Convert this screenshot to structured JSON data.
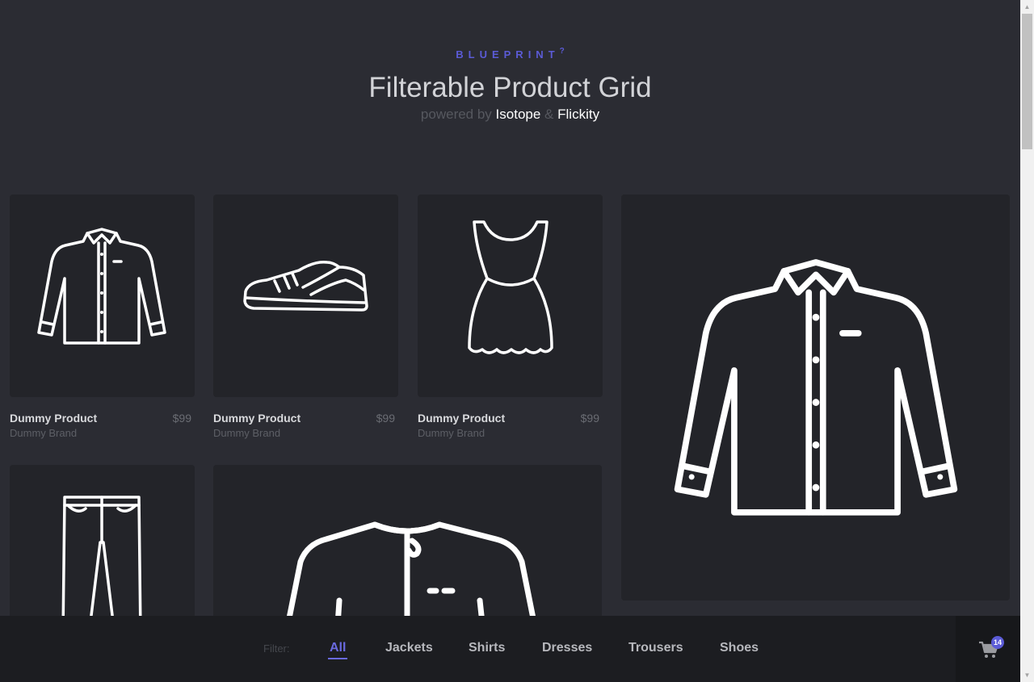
{
  "header": {
    "logo": "BLUEPRINT",
    "logo_sup": "?",
    "title": "Filterable Product Grid",
    "subtitle_prefix": "powered by",
    "link1": "Isotope",
    "amp": "&",
    "link2": "Flickity"
  },
  "products": [
    {
      "name": "Dummy Product",
      "brand": "Dummy Brand",
      "price": "$99",
      "icon": "shirt-icon"
    },
    {
      "name": "Dummy Product",
      "brand": "Dummy Brand",
      "price": "$99",
      "icon": "shoe-icon"
    },
    {
      "name": "Dummy Product",
      "brand": "Dummy Brand",
      "price": "$99",
      "icon": "dress-icon"
    },
    {
      "name": "",
      "brand": "",
      "price": "",
      "icon": "shirt-icon"
    },
    {
      "name": "",
      "brand": "",
      "price": "",
      "icon": "trousers-icon"
    },
    {
      "name": "",
      "brand": "",
      "price": "",
      "icon": "jacket-icon"
    }
  ],
  "filter": {
    "label": "Filter:",
    "items": [
      "All",
      "Jackets",
      "Shirts",
      "Dresses",
      "Trousers",
      "Shoes"
    ],
    "active": "All"
  },
  "cart": {
    "count": "14",
    "icon": "cart-icon"
  },
  "colors": {
    "background": "#2b2c33",
    "card": "#232429",
    "accent": "#5b5bd6",
    "filterbar": "#1c1d21"
  }
}
